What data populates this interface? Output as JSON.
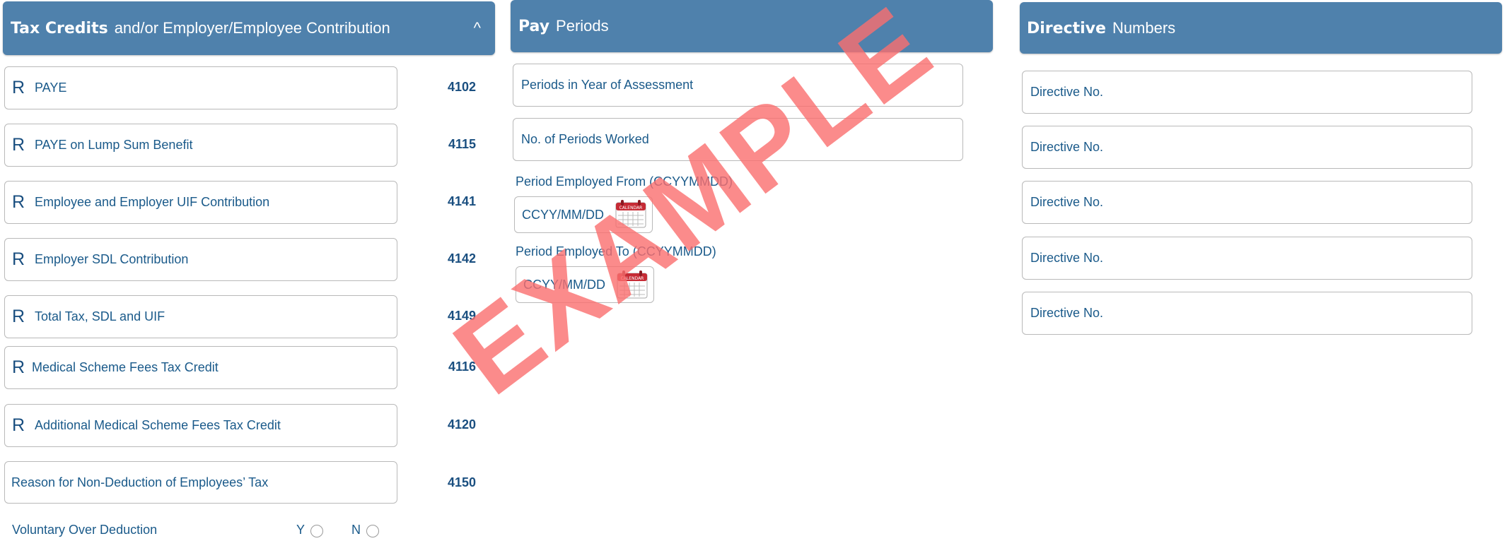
{
  "tax_panel": {
    "title_bold": "Tax Credits",
    "title_rest": "and/or Employer/Employee Contribution",
    "caret": "^",
    "rows": [
      {
        "prefix": "R",
        "label": "PAYE",
        "code": "4102"
      },
      {
        "prefix": "R",
        "label": "PAYE on Lump Sum Benefit",
        "code": "4115"
      },
      {
        "prefix": "R",
        "label": "Employee and Employer UIF Contribution",
        "code": "4141"
      },
      {
        "prefix": "R",
        "label": "Employer SDL Contribution",
        "code": "4142"
      },
      {
        "prefix": "R",
        "label": "Total Tax, SDL and UIF",
        "code": "4149"
      },
      {
        "prefix": "R",
        "label": "Medical Scheme Fees Tax Credit",
        "code": "4116"
      },
      {
        "prefix": "R",
        "label": "Additional Medical Scheme Fees Tax Credit",
        "code": "4120"
      }
    ],
    "reason": {
      "label": "Reason for Non-Deduction of Employees’ Tax",
      "code": "4150"
    },
    "voluntary": {
      "label": "Voluntary Over Deduction",
      "yes": "Y",
      "no": "N"
    }
  },
  "pay_panel": {
    "title_bold": "Pay",
    "title_rest": "Periods",
    "periods_in_year": "Periods in Year of Assessment",
    "periods_worked": "No. of Periods Worked",
    "from_label": "Period Employed From (CCYYMMDD)",
    "from_placeholder": "CCYY/MM/DD",
    "to_label": "Period Employed To (CCYYMMDD)",
    "to_placeholder": "CCYY/MM/DD",
    "calendar_text": "CALENDAR",
    "calendar_icon": "calendar-icon"
  },
  "directive_panel": {
    "title_bold": "Directive",
    "title_rest": "Numbers",
    "fields": [
      "Directive No.",
      "Directive No.",
      "Directive No.",
      "Directive No.",
      "Directive No."
    ]
  },
  "watermark": "EXAMPLE",
  "colors": {
    "header": "#4f81ac",
    "text": "#1a5a8a",
    "watermark": "#fb6f6f",
    "calendar": "#c62b35"
  }
}
